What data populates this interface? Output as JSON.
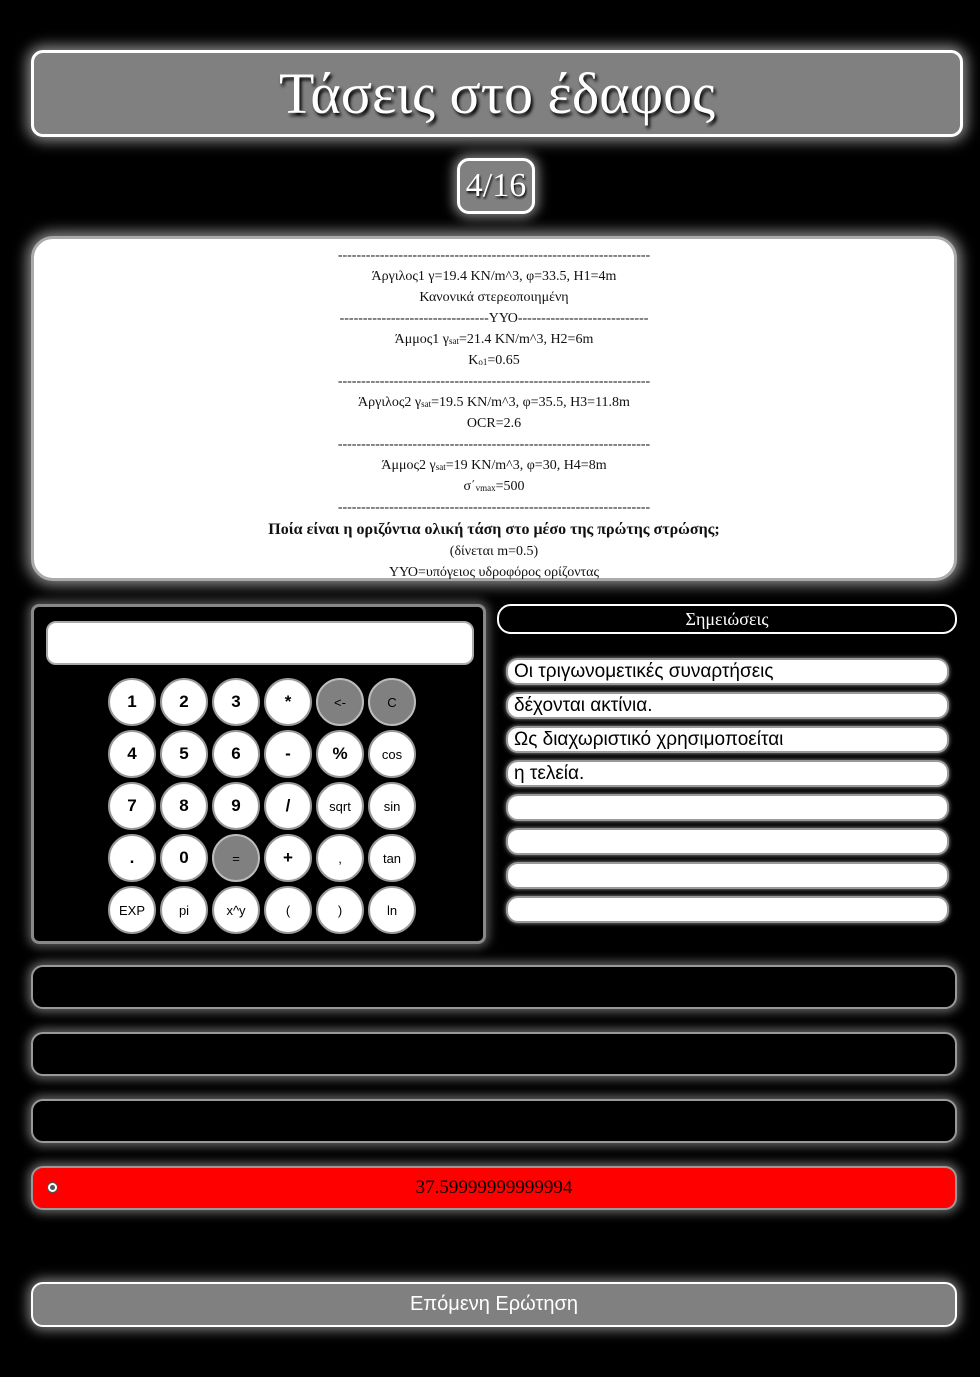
{
  "title": "Τάσεις στο έδαφος",
  "counter": "4/16",
  "problem": {
    "sep": "-------------------------------------------------------------------",
    "l1": "Άργιλος1 γ=19.4 KN/m^3, φ=33.5, H1=4m",
    "l2": "Κανονικά στερεοποιημένη",
    "yyo_sep": "--------------------------------ΥΥΟ----------------------------",
    "l3_a": "Άμμος1 γ",
    "l3_sub": "sat",
    "l3_b": "=21.4 KN/m^3, H2=6m",
    "l4_a": "K",
    "l4_sub": "o1",
    "l4_b": "=0.65",
    "l5_a": "Άργιλος2 γ",
    "l5_sub": "sat",
    "l5_b": "=19.5 KN/m^3, φ=35.5, H3=11.8m",
    "l6": "OCR=2.6",
    "l7_a": "Άμμος2 γ",
    "l7_sub": "sat",
    "l7_b": "=19 KN/m^3, φ=30, H4=8m",
    "l8_a": "σ΄",
    "l8_sub": "vmax",
    "l8_b": "=500",
    "question": "Ποία είναι η οριζόντια ολική τάση στο μέσο της πρώτης στρώσης;",
    "hint": "(δίνεται m=0.5)",
    "legend": "ΥΥΟ=υπόγειος υδροφόρος ορίζοντας"
  },
  "calculator": {
    "display_value": "",
    "keys": [
      [
        "1",
        "2",
        "3",
        "*",
        "<-",
        "C"
      ],
      [
        "4",
        "5",
        "6",
        "-",
        "%",
        "cos"
      ],
      [
        "7",
        "8",
        "9",
        "/",
        "sqrt",
        "sin"
      ],
      [
        ".",
        "0",
        "=",
        "+",
        ",",
        "tan"
      ],
      [
        "EXP",
        "pi",
        "x^y",
        "(",
        ")",
        "ln"
      ]
    ]
  },
  "notes": {
    "header": "Σημειώσεις",
    "lines": [
      "Οι τριγωνομετικές συναρτήσεις",
      "δέχονται ακτίνια.",
      "Ως διαχωριστικό χρησιμοποείται",
      "η τελεία.",
      "",
      "",
      "",
      ""
    ]
  },
  "answers": [
    {
      "text": "",
      "selected": false
    },
    {
      "text": "",
      "selected": false
    },
    {
      "text": "",
      "selected": false
    },
    {
      "text": "37.59999999999994",
      "selected": true
    }
  ],
  "colors": {
    "selected_answer": "#ff0000",
    "panel_gray": "#808080"
  },
  "next_button": "Επόμενη Ερώτηση"
}
